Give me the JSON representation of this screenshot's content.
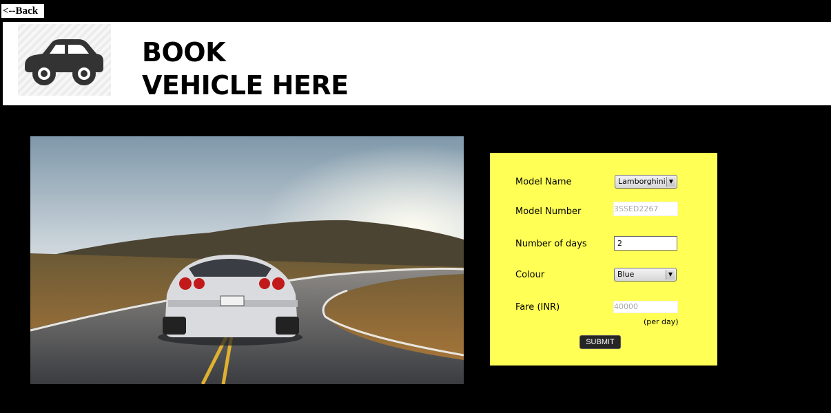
{
  "nav": {
    "back_label": "<--Back"
  },
  "header": {
    "title_line1": "BOOK",
    "title_line2": "VEHICLE HERE"
  },
  "hero": {
    "alt": ""
  },
  "form": {
    "model_name_label": "Model Name",
    "model_name_value": "Lamborghini",
    "model_number_label": "Model Number",
    "model_number_value": "3SSED2267",
    "days_label": "Number of days",
    "days_value": "2",
    "colour_label": "Colour",
    "colour_value": "Blue",
    "fare_label": "Fare (INR)",
    "fare_value": "40000",
    "fare_note": "(per day)",
    "submit_label": "SUBMIT"
  },
  "colors": {
    "panel": "#ffff55",
    "background": "#000000",
    "banner": "#ffffff"
  },
  "icons": {
    "logo": "car-icon",
    "dropdown": "chevron-down-icon"
  }
}
